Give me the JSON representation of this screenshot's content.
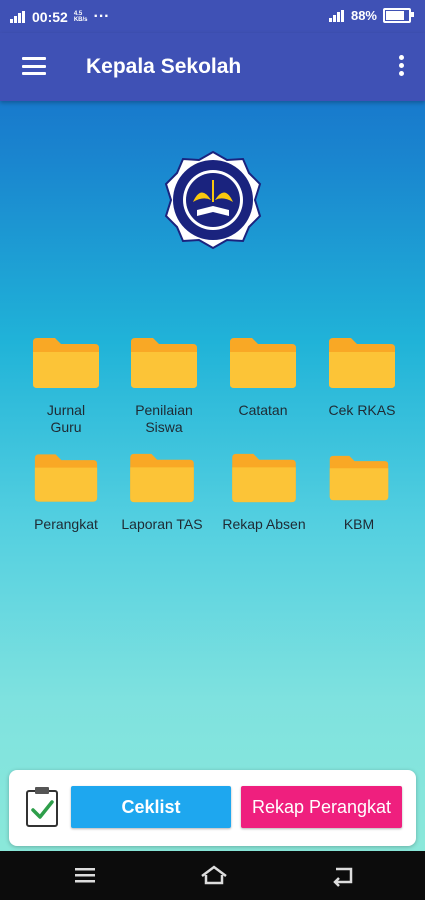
{
  "status": {
    "time": "00:52",
    "net_small": "4.5\nKB/s",
    "dots": "···",
    "battery": "88%",
    "battery_level": 0.88
  },
  "app": {
    "title": "Kepala Sekolah"
  },
  "menu": {
    "row1": [
      "Jurnal\nGuru",
      "Penilaian\nSiswa",
      "Catatan",
      "Cek RKAS"
    ],
    "row2": [
      "Perangkat",
      "Laporan TAS",
      "Rekap Absen",
      "KBM"
    ]
  },
  "buttons": {
    "ceklist": "Ceklist",
    "rekap": "Rekap Perangkat"
  },
  "colors": {
    "primary": "#3f51b5",
    "folder": "#f9a825",
    "ceklist": "#1ea7ef",
    "rekap": "#ef1f7e"
  }
}
